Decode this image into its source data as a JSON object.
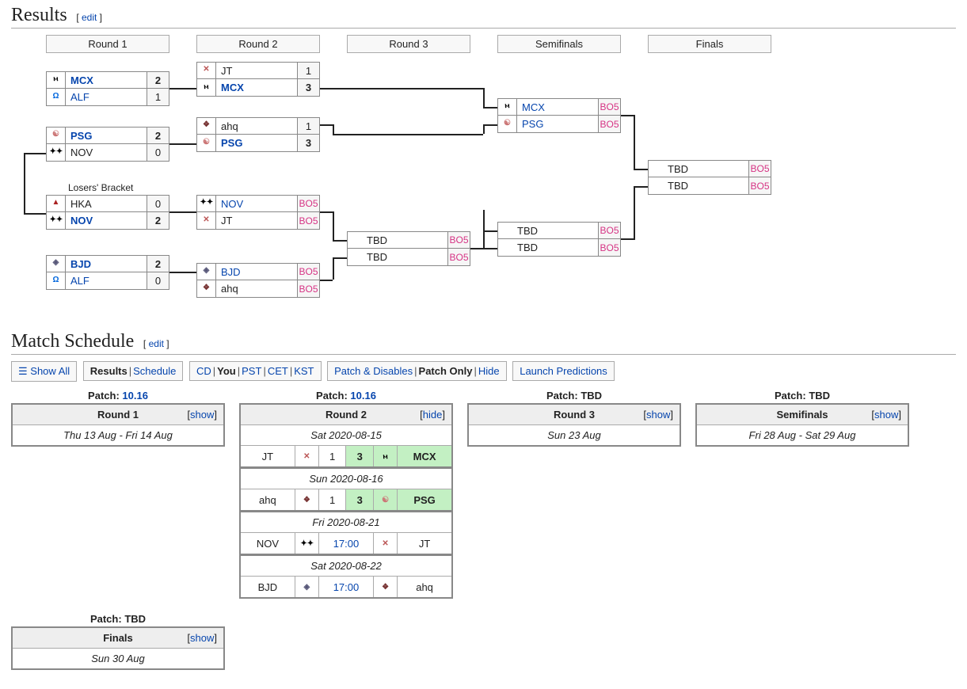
{
  "sections": {
    "results_title": "Results",
    "schedule_title": "Match Schedule",
    "edit": "edit"
  },
  "rounds": {
    "r1": "Round 1",
    "r2": "Round 2",
    "r3": "Round 3",
    "sf": "Semifinals",
    "fn": "Finals",
    "losers": "Losers' Bracket"
  },
  "teams": {
    "MCX": "MCX",
    "ALF": "ALF",
    "PSG": "PSG",
    "NOV": "NOV",
    "JT": "JT",
    "ahq": "ahq",
    "HKA": "HKA",
    "BJD": "BJD",
    "TBD": "TBD"
  },
  "icons": {
    "MCX": "ⲙ",
    "ALF": "Ω",
    "PSG": "☯",
    "NOV": "✦✦",
    "JT": "✕",
    "ahq": "❖",
    "HKA": "▲",
    "BJD": "◈"
  },
  "bracket": {
    "r1": [
      {
        "t1": "MCX",
        "s1": "2",
        "t2": "ALF",
        "s2": "1",
        "bold": 1
      },
      {
        "t1": "PSG",
        "s1": "2",
        "t2": "NOV",
        "s2": "0",
        "bold": 1
      },
      {
        "t1": "HKA",
        "s1": "0",
        "t2": "NOV",
        "s2": "2",
        "bold": 2
      },
      {
        "t1": "BJD",
        "s1": "2",
        "t2": "ALF",
        "s2": "0",
        "bold": 1
      }
    ],
    "r2": [
      {
        "t1": "JT",
        "s1": "1",
        "t2": "MCX",
        "s2": "3",
        "bold": 2
      },
      {
        "t1": "ahq",
        "s1": "1",
        "t2": "PSG",
        "s2": "3",
        "bold": 2
      },
      {
        "t1": "NOV",
        "s1": "BO5",
        "t2": "JT",
        "s2": "BO5"
      },
      {
        "t1": "BJD",
        "s1": "BO5",
        "t2": "ahq",
        "s2": "BO5"
      }
    ],
    "r3": [
      {
        "t1": "TBD",
        "s1": "BO5",
        "t2": "TBD",
        "s2": "BO5"
      }
    ],
    "sf": [
      {
        "t1": "MCX",
        "s1": "BO5",
        "t2": "PSG",
        "s2": "BO5"
      },
      {
        "t1": "TBD",
        "s1": "BO5",
        "t2": "TBD",
        "s2": "BO5"
      }
    ],
    "fn": [
      {
        "t1": "TBD",
        "s1": "BO5",
        "t2": "TBD",
        "s2": "BO5"
      }
    ]
  },
  "filters": {
    "showall": "Show All",
    "results": "Results",
    "schedule": "Schedule",
    "cd": "CD",
    "you": "You",
    "pst": "PST",
    "cet": "CET",
    "kst": "KST",
    "patch_disables": "Patch & Disables",
    "patch_only": "Patch Only",
    "hide": "Hide",
    "launch": "Launch Predictions"
  },
  "schedule": [
    {
      "patch_label": "Patch:",
      "patch": "10.16",
      "title": "Round 1",
      "toggle": "show",
      "dates": "Thu 13 Aug - Fri 14 Aug"
    },
    {
      "patch_label": "Patch:",
      "patch": "10.16",
      "title": "Round 2",
      "toggle": "hide",
      "days": [
        {
          "date": "Sat 2020-08-15",
          "matches": [
            {
              "t1": "JT",
              "s1": "1",
              "s2": "3",
              "t2": "MCX",
              "winner": 2
            }
          ]
        },
        {
          "date": "Sun 2020-08-16",
          "matches": [
            {
              "t1": "ahq",
              "s1": "1",
              "s2": "3",
              "t2": "PSG",
              "winner": 2
            }
          ]
        },
        {
          "date": "Fri 2020-08-21",
          "matches": [
            {
              "t1": "NOV",
              "time": "17:00",
              "t2": "JT"
            }
          ]
        },
        {
          "date": "Sat 2020-08-22",
          "matches": [
            {
              "t1": "BJD",
              "time": "17:00",
              "t2": "ahq"
            }
          ]
        }
      ]
    },
    {
      "patch_label": "Patch:",
      "patch": "TBD",
      "title": "Round 3",
      "toggle": "show",
      "dates": "Sun 23 Aug"
    },
    {
      "patch_label": "Patch:",
      "patch": "TBD",
      "title": "Semifinals",
      "toggle": "show",
      "dates": "Fri 28 Aug - Sat 29 Aug"
    },
    {
      "patch_label": "Patch:",
      "patch": "TBD",
      "title": "Finals",
      "toggle": "show",
      "dates": "Sun 30 Aug"
    }
  ],
  "misc": {
    "show": "show",
    "hide": "hide",
    "tbd": "TBD",
    "hamburger": "☰"
  }
}
